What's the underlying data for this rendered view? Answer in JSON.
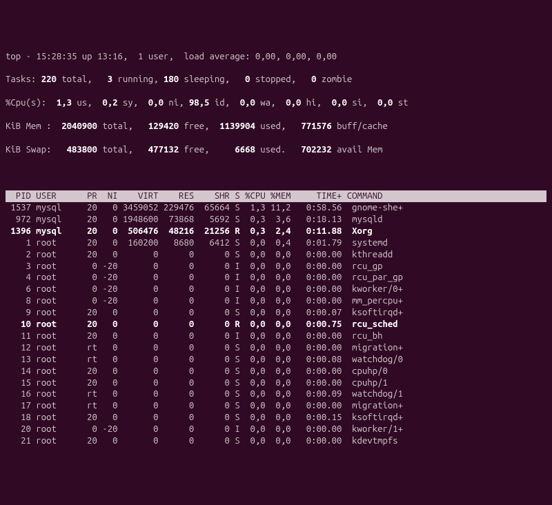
{
  "summary": {
    "line1_pre": "top - ",
    "time": "15:28:35",
    "up_label": " up ",
    "uptime": "13:16",
    "sep1": ",  ",
    "users": "1 user",
    "sep2": ",  load average: ",
    "load": "0,00, 0,00, 0,00",
    "tasks_label": "Tasks: ",
    "tasks_total": "220",
    "tasks_total_lbl": " total,   ",
    "tasks_running": "3",
    "tasks_running_lbl": " running, ",
    "tasks_sleeping": "180",
    "tasks_sleeping_lbl": " sleeping,   ",
    "tasks_stopped": "0",
    "tasks_stopped_lbl": " stopped,   ",
    "tasks_zombie": "0",
    "tasks_zombie_lbl": " zombie",
    "cpu_label": "%Cpu(s):  ",
    "cpu_us": "1,3",
    "cpu_us_lbl": " us,  ",
    "cpu_sy": "0,2",
    "cpu_sy_lbl": " sy,  ",
    "cpu_ni": "0,0",
    "cpu_ni_lbl": " ni, ",
    "cpu_id": "98,5",
    "cpu_id_lbl": " id,  ",
    "cpu_wa": "0,0",
    "cpu_wa_lbl": " wa,  ",
    "cpu_hi": "0,0",
    "cpu_hi_lbl": " hi,  ",
    "cpu_si": "0,0",
    "cpu_si_lbl": " si,  ",
    "cpu_st": "0,0",
    "cpu_st_lbl": " st",
    "mem_label": "KiB Mem :  ",
    "mem_total": "2040900",
    "mem_total_lbl": " total,   ",
    "mem_free": "129420",
    "mem_free_lbl": " free,  ",
    "mem_used": "1139904",
    "mem_used_lbl": " used,   ",
    "mem_buff": "771576",
    "mem_buff_lbl": " buff/cache",
    "swap_label": "KiB Swap:   ",
    "swap_total": "483800",
    "swap_total_lbl": " total,   ",
    "swap_free": "477132",
    "swap_free_lbl": " free,     ",
    "swap_used": "6668",
    "swap_used_lbl": " used.   ",
    "swap_avail": "702232",
    "swap_avail_lbl": " avail Mem"
  },
  "columns": [
    "PID",
    "USER",
    "PR",
    "NI",
    "VIRT",
    "RES",
    "SHR",
    "S",
    "%CPU",
    "%MEM",
    "TIME+",
    "COMMAND"
  ],
  "processes": [
    {
      "pid": "1537",
      "user": "mysql",
      "pr": "20",
      "ni": "0",
      "virt": "3459052",
      "res": "229476",
      "shr": "65664",
      "s": "S",
      "cpu": "1,3",
      "mem": "11,2",
      "time": "0:58.56",
      "cmd": "gnome-she+",
      "bold": false
    },
    {
      "pid": "972",
      "user": "mysql",
      "pr": "20",
      "ni": "0",
      "virt": "1948600",
      "res": "73868",
      "shr": "5692",
      "s": "S",
      "cpu": "0,3",
      "mem": "3,6",
      "time": "0:18.13",
      "cmd": "mysqld",
      "bold": false
    },
    {
      "pid": "1396",
      "user": "mysql",
      "pr": "20",
      "ni": "0",
      "virt": "506476",
      "res": "48216",
      "shr": "21256",
      "s": "R",
      "cpu": "0,3",
      "mem": "2,4",
      "time": "0:11.88",
      "cmd": "Xorg",
      "bold": true
    },
    {
      "pid": "1",
      "user": "root",
      "pr": "20",
      "ni": "0",
      "virt": "160200",
      "res": "8680",
      "shr": "6412",
      "s": "S",
      "cpu": "0,0",
      "mem": "0,4",
      "time": "0:01.79",
      "cmd": "systemd",
      "bold": false
    },
    {
      "pid": "2",
      "user": "root",
      "pr": "20",
      "ni": "0",
      "virt": "0",
      "res": "0",
      "shr": "0",
      "s": "S",
      "cpu": "0,0",
      "mem": "0,0",
      "time": "0:00.00",
      "cmd": "kthreadd",
      "bold": false
    },
    {
      "pid": "3",
      "user": "root",
      "pr": "0",
      "ni": "-20",
      "virt": "0",
      "res": "0",
      "shr": "0",
      "s": "I",
      "cpu": "0,0",
      "mem": "0,0",
      "time": "0:00.00",
      "cmd": "rcu_gp",
      "bold": false
    },
    {
      "pid": "4",
      "user": "root",
      "pr": "0",
      "ni": "-20",
      "virt": "0",
      "res": "0",
      "shr": "0",
      "s": "I",
      "cpu": "0,0",
      "mem": "0,0",
      "time": "0:00.00",
      "cmd": "rcu_par_gp",
      "bold": false
    },
    {
      "pid": "6",
      "user": "root",
      "pr": "0",
      "ni": "-20",
      "virt": "0",
      "res": "0",
      "shr": "0",
      "s": "I",
      "cpu": "0,0",
      "mem": "0,0",
      "time": "0:00.00",
      "cmd": "kworker/0+",
      "bold": false
    },
    {
      "pid": "8",
      "user": "root",
      "pr": "0",
      "ni": "-20",
      "virt": "0",
      "res": "0",
      "shr": "0",
      "s": "I",
      "cpu": "0,0",
      "mem": "0,0",
      "time": "0:00.00",
      "cmd": "mm_percpu+",
      "bold": false
    },
    {
      "pid": "9",
      "user": "root",
      "pr": "20",
      "ni": "0",
      "virt": "0",
      "res": "0",
      "shr": "0",
      "s": "S",
      "cpu": "0,0",
      "mem": "0,0",
      "time": "0:00.07",
      "cmd": "ksoftirqd+",
      "bold": false
    },
    {
      "pid": "10",
      "user": "root",
      "pr": "20",
      "ni": "0",
      "virt": "0",
      "res": "0",
      "shr": "0",
      "s": "R",
      "cpu": "0,0",
      "mem": "0,0",
      "time": "0:00.75",
      "cmd": "rcu_sched",
      "bold": true
    },
    {
      "pid": "11",
      "user": "root",
      "pr": "20",
      "ni": "0",
      "virt": "0",
      "res": "0",
      "shr": "0",
      "s": "I",
      "cpu": "0,0",
      "mem": "0,0",
      "time": "0:00.00",
      "cmd": "rcu_bh",
      "bold": false
    },
    {
      "pid": "12",
      "user": "root",
      "pr": "rt",
      "ni": "0",
      "virt": "0",
      "res": "0",
      "shr": "0",
      "s": "S",
      "cpu": "0,0",
      "mem": "0,0",
      "time": "0:00.00",
      "cmd": "migration+",
      "bold": false
    },
    {
      "pid": "13",
      "user": "root",
      "pr": "rt",
      "ni": "0",
      "virt": "0",
      "res": "0",
      "shr": "0",
      "s": "S",
      "cpu": "0,0",
      "mem": "0,0",
      "time": "0:00.08",
      "cmd": "watchdog/0",
      "bold": false
    },
    {
      "pid": "14",
      "user": "root",
      "pr": "20",
      "ni": "0",
      "virt": "0",
      "res": "0",
      "shr": "0",
      "s": "S",
      "cpu": "0,0",
      "mem": "0,0",
      "time": "0:00.00",
      "cmd": "cpuhp/0",
      "bold": false
    },
    {
      "pid": "15",
      "user": "root",
      "pr": "20",
      "ni": "0",
      "virt": "0",
      "res": "0",
      "shr": "0",
      "s": "S",
      "cpu": "0,0",
      "mem": "0,0",
      "time": "0:00.00",
      "cmd": "cpuhp/1",
      "bold": false
    },
    {
      "pid": "16",
      "user": "root",
      "pr": "rt",
      "ni": "0",
      "virt": "0",
      "res": "0",
      "shr": "0",
      "s": "S",
      "cpu": "0,0",
      "mem": "0,0",
      "time": "0:00.09",
      "cmd": "watchdog/1",
      "bold": false
    },
    {
      "pid": "17",
      "user": "root",
      "pr": "rt",
      "ni": "0",
      "virt": "0",
      "res": "0",
      "shr": "0",
      "s": "S",
      "cpu": "0,0",
      "mem": "0,0",
      "time": "0:00.00",
      "cmd": "migration+",
      "bold": false
    },
    {
      "pid": "18",
      "user": "root",
      "pr": "20",
      "ni": "0",
      "virt": "0",
      "res": "0",
      "shr": "0",
      "s": "S",
      "cpu": "0,0",
      "mem": "0,0",
      "time": "0:00.15",
      "cmd": "ksoftirqd+",
      "bold": false
    },
    {
      "pid": "20",
      "user": "root",
      "pr": "0",
      "ni": "-20",
      "virt": "0",
      "res": "0",
      "shr": "0",
      "s": "I",
      "cpu": "0,0",
      "mem": "0,0",
      "time": "0:00.00",
      "cmd": "kworker/1+",
      "bold": false
    },
    {
      "pid": "21",
      "user": "root",
      "pr": "20",
      "ni": "0",
      "virt": "0",
      "res": "0",
      "shr": "0",
      "s": "S",
      "cpu": "0,0",
      "mem": "0,0",
      "time": "0:00.00",
      "cmd": "kdevtmpfs",
      "bold": false
    }
  ]
}
